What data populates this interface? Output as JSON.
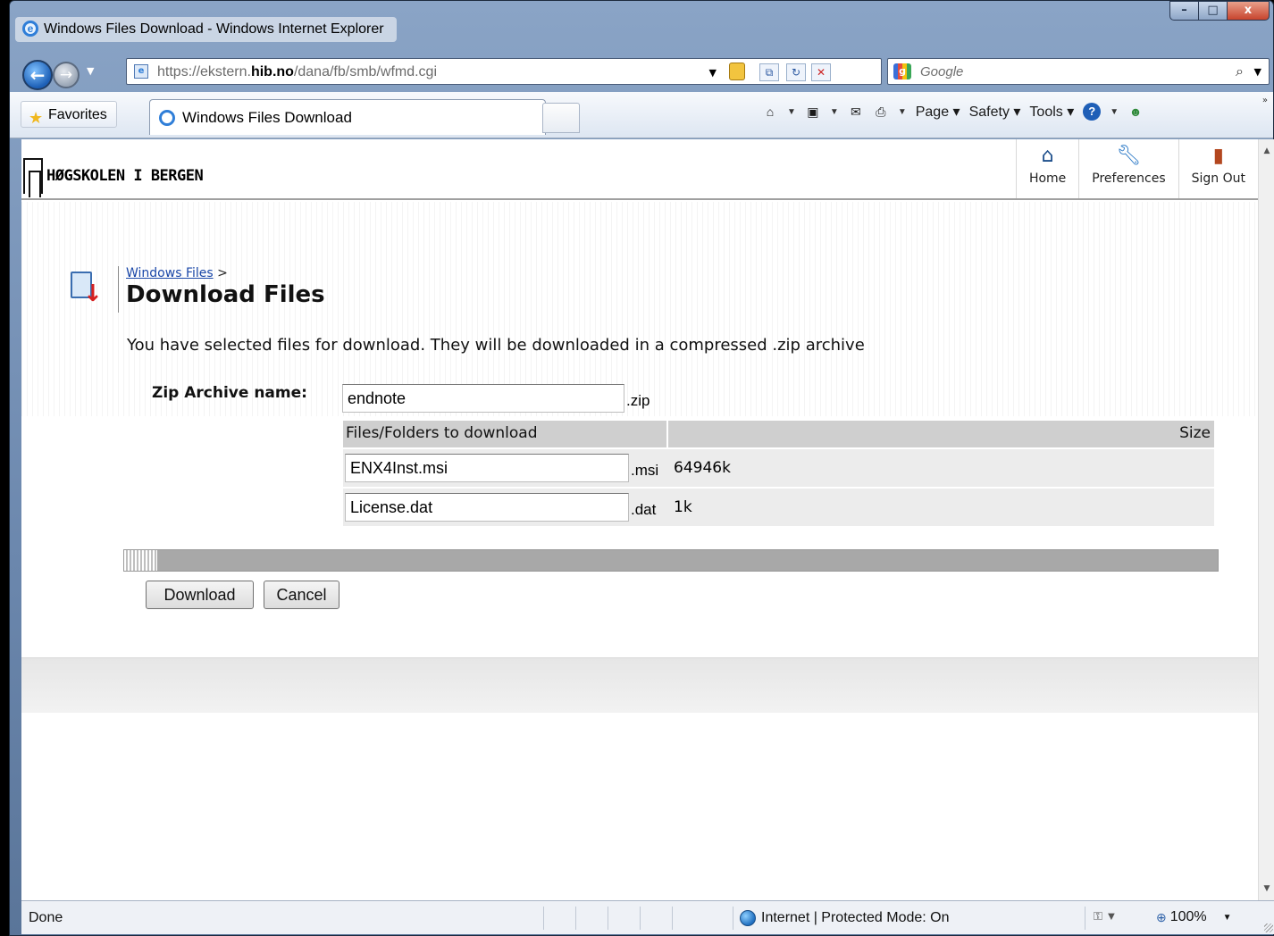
{
  "window": {
    "title": "Windows Files Download - Windows Internet Explorer",
    "min_glyph": "–",
    "max_glyph": "□",
    "close_glyph": "x"
  },
  "addressbar": {
    "url_prefix": "https://",
    "url_host_pre": "ekstern.",
    "url_host": "hib.no",
    "url_path": "/dana/fb/smb/wfmd.cgi",
    "search_placeholder": "Google"
  },
  "favbar": {
    "favorites_label": "Favorites",
    "tab_title": "Windows Files Download",
    "menus": [
      {
        "label": "Page"
      },
      {
        "label": "Safety"
      },
      {
        "label": "Tools"
      }
    ]
  },
  "site": {
    "logo_text": "HØGSKOLEN I BERGEN",
    "nav": [
      {
        "label": "Home",
        "icon": "home-icon"
      },
      {
        "label": "Preferences",
        "icon": "wrench-icon"
      },
      {
        "label": "Sign Out",
        "icon": "door-icon"
      }
    ]
  },
  "page": {
    "breadcrumb_link": "Windows Files",
    "breadcrumb_sep": ">",
    "title": "Download Files",
    "intro": "You have selected files for download. They will be downloaded in a compressed .zip archive",
    "zip_label": "Zip Archive name:",
    "zip_value": "endnote",
    "zip_ext": ".zip",
    "table": {
      "col_files": "Files/Folders to download",
      "col_size": "Size",
      "rows": [
        {
          "name": "ENX4Inst.msi",
          "ext": ".msi",
          "size": "64946k"
        },
        {
          "name": "License.dat",
          "ext": ".dat",
          "size": "1k"
        }
      ]
    },
    "progress_fraction": 0.03,
    "download_label": "Download",
    "cancel_label": "Cancel"
  },
  "statusbar": {
    "status": "Done",
    "zone": "Internet | Protected Mode: On",
    "zoom": "100%"
  }
}
